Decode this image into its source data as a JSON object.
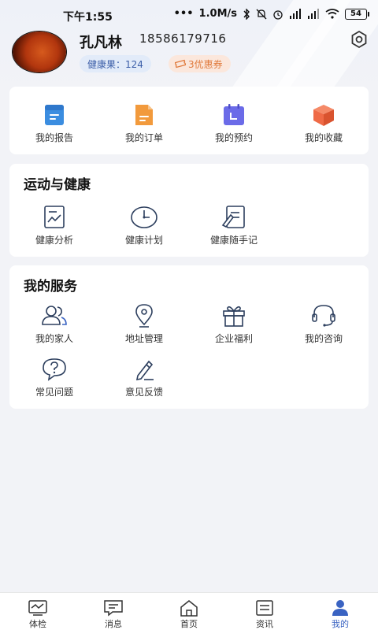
{
  "status_bar": {
    "time": "下午1:55",
    "network_speed": "1.0M/s",
    "battery": "54"
  },
  "profile": {
    "name": "孔凡林",
    "phone": "18586179716",
    "health_fruit": "健康果：124",
    "coupon": "3优惠券"
  },
  "quick_links": [
    {
      "label": "我的报告",
      "icon": "report-icon",
      "color": "#3b8de0"
    },
    {
      "label": "我的订单",
      "icon": "order-icon",
      "color": "#f29a3c"
    },
    {
      "label": "我的预约",
      "icon": "calendar-icon",
      "color": "#6b6be8"
    },
    {
      "label": "我的收藏",
      "icon": "box-icon",
      "color": "#ef6a46"
    }
  ],
  "sport_health": {
    "title": "运动与健康",
    "items": [
      {
        "label": "健康分析",
        "icon": "chart-icon"
      },
      {
        "label": "健康计划",
        "icon": "clock-icon"
      },
      {
        "label": "健康随手记",
        "icon": "notebook-icon"
      }
    ]
  },
  "services": {
    "title": "我的服务",
    "items": [
      {
        "label": "我的家人",
        "icon": "family-icon"
      },
      {
        "label": "地址管理",
        "icon": "location-icon"
      },
      {
        "label": "企业福利",
        "icon": "gift-icon"
      },
      {
        "label": "我的咨询",
        "icon": "headset-icon"
      },
      {
        "label": "常见问题",
        "icon": "question-icon"
      },
      {
        "label": "意见反馈",
        "icon": "pencil-icon"
      }
    ]
  },
  "bottom_nav": [
    {
      "label": "体检",
      "icon": "checkup-icon"
    },
    {
      "label": "消息",
      "icon": "message-icon"
    },
    {
      "label": "首页",
      "icon": "home-icon"
    },
    {
      "label": "资讯",
      "icon": "news-icon"
    },
    {
      "label": "我的",
      "icon": "profile-icon",
      "active": true
    }
  ],
  "colors": {
    "accent": "#3a63c2",
    "background": "#f2f3f7",
    "health_badge_bg": "#e2ebf9",
    "coupon_badge_bg": "#fbe7dc"
  }
}
